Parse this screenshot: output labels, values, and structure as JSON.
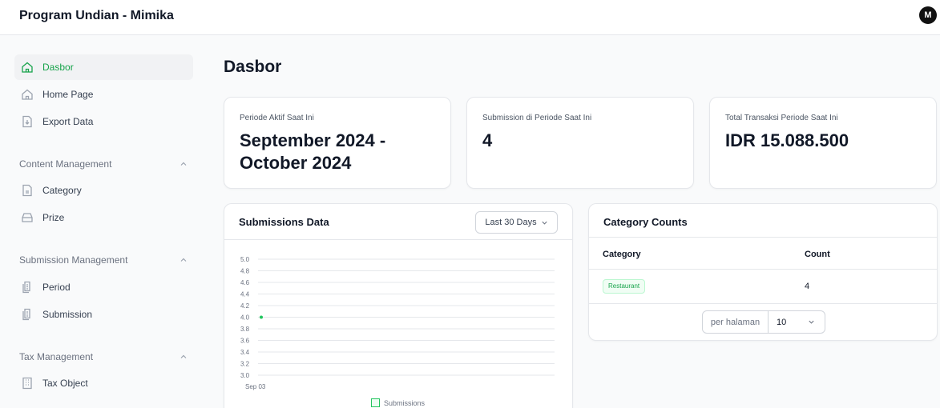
{
  "app": {
    "title": "Program Undian - Mimika",
    "user_initial": "M"
  },
  "sidebar": {
    "top_items": [
      {
        "label": "Dasbor",
        "icon": "home-icon",
        "active": true
      },
      {
        "label": "Home Page",
        "icon": "home-icon"
      },
      {
        "label": "Export Data",
        "icon": "download-file-icon"
      }
    ],
    "groups": [
      {
        "label": "Content Management",
        "items": [
          {
            "label": "Category",
            "icon": "file-icon"
          },
          {
            "label": "Prize",
            "icon": "inbox-icon"
          }
        ]
      },
      {
        "label": "Submission Management",
        "items": [
          {
            "label": "Period",
            "icon": "documents-icon"
          },
          {
            "label": "Submission",
            "icon": "documents-icon"
          }
        ]
      },
      {
        "label": "Tax Management",
        "items": [
          {
            "label": "Tax Object",
            "icon": "building-icon"
          }
        ]
      }
    ]
  },
  "main": {
    "page_title": "Dasbor",
    "stats": [
      {
        "label": "Periode Aktif Saat Ini",
        "value": "September 2024 - October 2024"
      },
      {
        "label": "Submission di Periode Saat Ini",
        "value": "4"
      },
      {
        "label": "Total Transaksi Periode Saat Ini",
        "value": "IDR 15.088.500"
      }
    ],
    "submissions": {
      "title": "Submissions Data",
      "range_label": "Last 30 Days"
    },
    "category_counts": {
      "title": "Category Counts",
      "columns": [
        "Category",
        "Count"
      ],
      "rows": [
        {
          "category": "Restaurant",
          "count": "4"
        }
      ],
      "pager": {
        "label": "per halaman",
        "value": "10"
      }
    }
  },
  "colors": {
    "accent": "#16a34a",
    "series": "#22c55e"
  },
  "chart_data": {
    "type": "line",
    "x": [
      "Sep 03"
    ],
    "series": [
      {
        "name": "Submissions",
        "values": [
          4
        ]
      }
    ],
    "y_ticks": [
      "5.0",
      "4.8",
      "4.6",
      "4.4",
      "4.2",
      "4.0",
      "3.8",
      "3.6",
      "3.4",
      "3.2",
      "3.0"
    ],
    "ylim": [
      3.0,
      5.0
    ],
    "grid": true,
    "legend": "bottom"
  }
}
